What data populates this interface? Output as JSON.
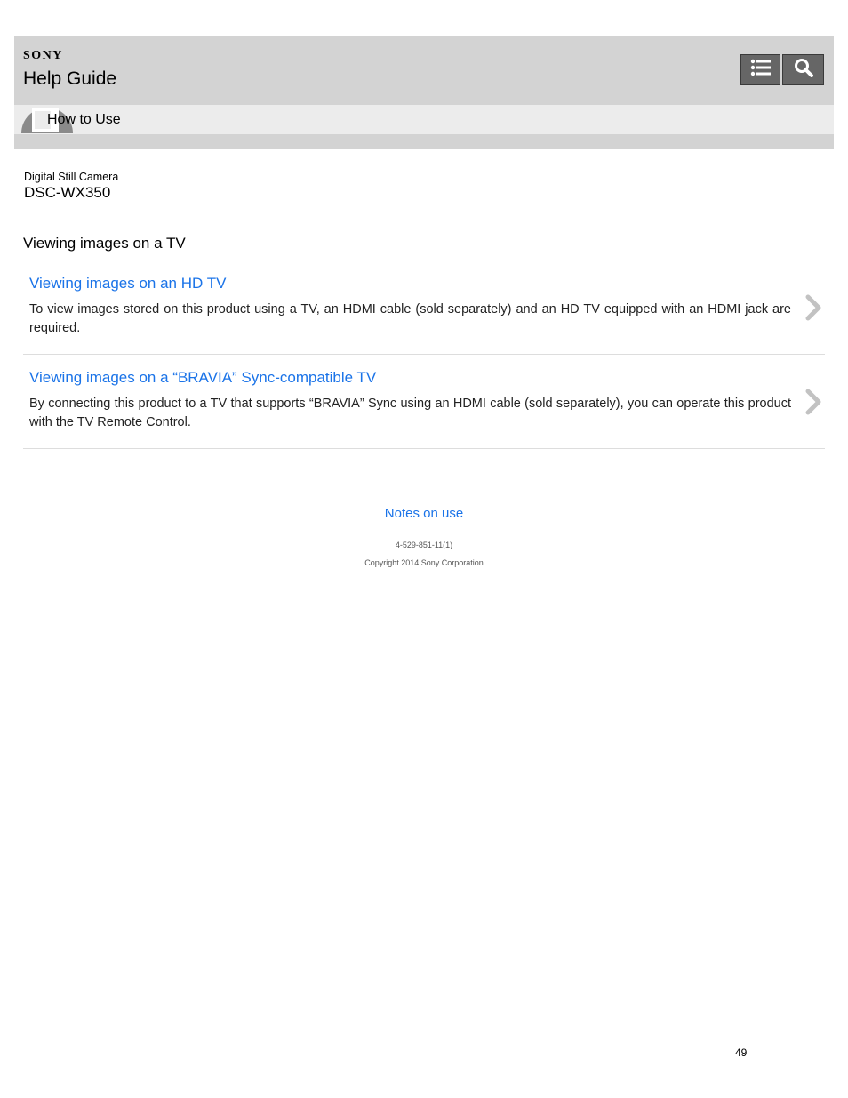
{
  "header": {
    "brand": "SONY",
    "title": "Help Guide",
    "buttons": [
      {
        "icon": "list-icon"
      },
      {
        "icon": "search-icon"
      }
    ],
    "breadcrumb_category": "How to Use"
  },
  "product": {
    "type": "Digital Still Camera",
    "model": "DSC-WX350"
  },
  "page_title": "Viewing images on a TV",
  "items": [
    {
      "link": "Viewing images on an HD TV",
      "description": "To view images stored on this product using a TV, an HDMI cable (sold separately) and an HD TV equipped with an HDMI jack are required."
    },
    {
      "link": "Viewing images on a “BRAVIA” Sync-compatible TV",
      "description": "By connecting this product to a TV that supports “BRAVIA” Sync using an HDMI cable (sold separately), you can operate this product with the TV Remote Control."
    }
  ],
  "footer": {
    "notes_link": "Notes on use",
    "doc_number": "4-529-851-11(1)",
    "copyright": "Copyright 2014 Sony Corporation"
  },
  "page_number": "49",
  "colors": {
    "header_bg": "#d3d3d3",
    "subbar_bg": "#ececec",
    "button_bg": "#666666",
    "link": "#1a73e8"
  }
}
